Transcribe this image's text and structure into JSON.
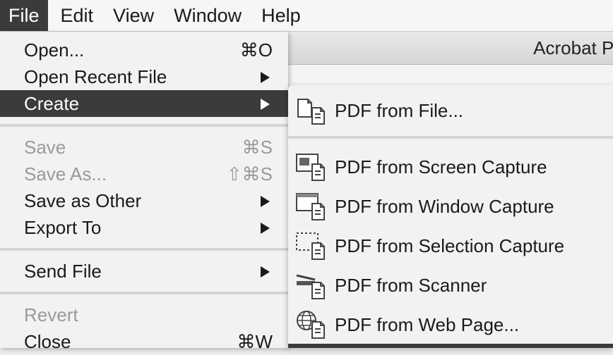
{
  "menubar": {
    "file": "File",
    "edit": "Edit",
    "view": "View",
    "window": "Window",
    "help": "Help"
  },
  "app": {
    "title": "Acrobat Pr"
  },
  "file_menu": {
    "open": {
      "label": "Open...",
      "shortcut": "⌘O"
    },
    "open_recent": {
      "label": "Open Recent File"
    },
    "create": {
      "label": "Create"
    },
    "save": {
      "label": "Save",
      "shortcut": "⌘S"
    },
    "save_as": {
      "label": "Save As...",
      "shortcut": "⇧⌘S"
    },
    "save_as_other": {
      "label": "Save as Other"
    },
    "export_to": {
      "label": "Export To"
    },
    "send_file": {
      "label": "Send File"
    },
    "revert": {
      "label": "Revert"
    },
    "close": {
      "label": "Close",
      "shortcut": "⌘W"
    }
  },
  "create_submenu": {
    "items": [
      {
        "label": "PDF from File...",
        "icon": "pdf-from-file-icon"
      },
      {
        "label": "PDF from Screen Capture",
        "icon": "screen-capture-icon"
      },
      {
        "label": "PDF from Window Capture",
        "icon": "window-capture-icon"
      },
      {
        "label": "PDF from Selection Capture",
        "icon": "selection-capture-icon"
      },
      {
        "label": "PDF from Scanner",
        "icon": "scanner-icon"
      },
      {
        "label": "PDF from Web Page...",
        "icon": "web-page-icon"
      }
    ]
  },
  "colors": {
    "highlight": "#3b3b3b",
    "menu_bg": "#f2f2f2",
    "disabled_text": "#9a9a9a"
  }
}
